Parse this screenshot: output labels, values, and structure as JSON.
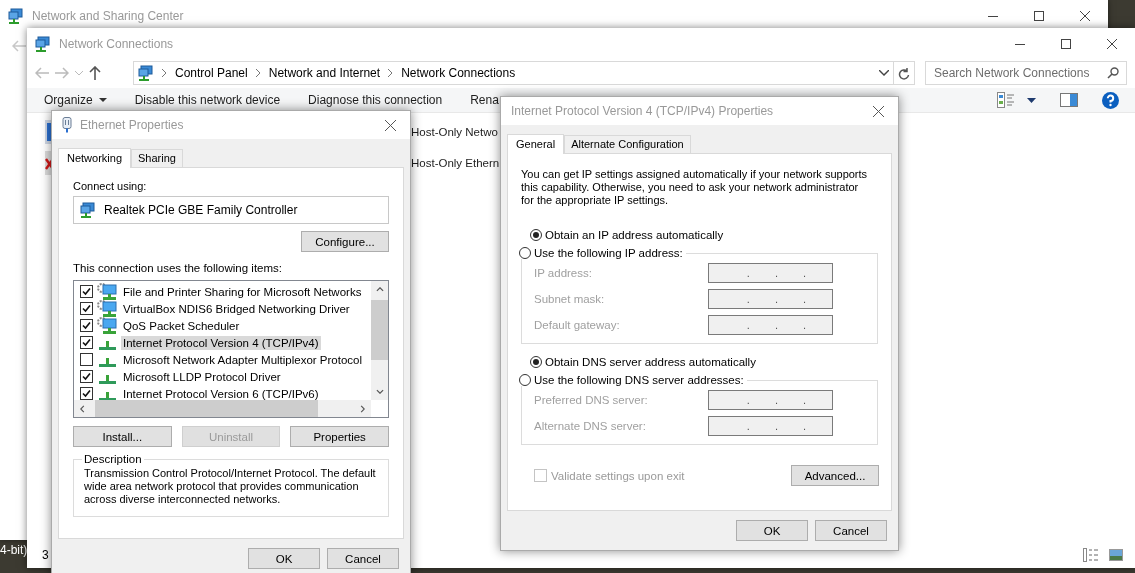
{
  "desktop": {
    "icon_label": "4-bit)"
  },
  "back_window": {
    "title": "Network and Sharing Center"
  },
  "explorer": {
    "title": "Network Connections",
    "breadcrumb": [
      "Control Panel",
      "Network and Internet",
      "Network Connections"
    ],
    "search": {
      "placeholder": "Search Network Connections"
    },
    "commands": [
      {
        "label": "Organize",
        "kind": "menu"
      },
      {
        "label": "Disable this network device",
        "kind": "action"
      },
      {
        "label": "Diagnose this connection",
        "kind": "action"
      },
      {
        "label": "Rena",
        "kind": "action"
      }
    ],
    "connections": [
      {
        "name": "Host-Only Netwo",
        "kind": "connected"
      },
      {
        "name": "Host-Only Ethern",
        "kind": "disconnected"
      }
    ],
    "status_bar": {
      "count": "3"
    }
  },
  "ethernet": {
    "title": "Ethernet Properties",
    "tabs": [
      {
        "label": "Networking",
        "selected": true
      },
      {
        "label": "Sharing",
        "selected": false
      }
    ],
    "connect_label": "Connect using:",
    "adapter": "Realtek PCIe GBE Family Controller",
    "configure": "Configure...",
    "items_label": "This connection uses the following items:",
    "items": [
      {
        "label": "File and Printer Sharing for Microsoft Networks",
        "kind": "service",
        "checked": true,
        "selected": false
      },
      {
        "label": "VirtualBox NDIS6 Bridged Networking Driver",
        "kind": "service",
        "checked": true,
        "selected": false
      },
      {
        "label": "QoS Packet Scheduler",
        "kind": "service",
        "checked": true,
        "selected": false
      },
      {
        "label": "Internet Protocol Version 4 (TCP/IPv4)",
        "kind": "protocol",
        "checked": true,
        "selected": true
      },
      {
        "label": "Microsoft Network Adapter Multiplexor Protocol",
        "kind": "protocol",
        "checked": false,
        "selected": false
      },
      {
        "label": "Microsoft LLDP Protocol Driver",
        "kind": "protocol",
        "checked": true,
        "selected": false
      },
      {
        "label": "Internet Protocol Version 6 (TCP/IPv6)",
        "kind": "protocol",
        "checked": true,
        "selected": false
      }
    ],
    "actions": [
      {
        "label": "Install...",
        "disabled": false
      },
      {
        "label": "Uninstall",
        "disabled": true
      },
      {
        "label": "Properties",
        "disabled": false
      }
    ],
    "description_title": "Description",
    "description": "Transmission Control Protocol/Internet Protocol. The default wide area network protocol that provides communication across diverse interconnected networks.",
    "ok": "OK",
    "cancel": "Cancel"
  },
  "ipv4": {
    "title": "Internet Protocol Version 4 (TCP/IPv4) Properties",
    "tabs": [
      {
        "label": "General",
        "selected": true
      },
      {
        "label": "Alternate Configuration",
        "selected": false
      }
    ],
    "intro": "You can get IP settings assigned automatically if your network supports this capability. Otherwise, you need to ask your network administrator for the appropriate IP settings.",
    "ip_options": [
      {
        "label": "Obtain an IP address automatically",
        "selected": true
      },
      {
        "label": "Use the following IP address:",
        "selected": false
      }
    ],
    "ip_fields": [
      {
        "label": "IP address:",
        "value": ". . .",
        "disabled": true
      },
      {
        "label": "Subnet mask:",
        "value": ". . .",
        "disabled": true
      },
      {
        "label": "Default gateway:",
        "value": ". . .",
        "disabled": true
      }
    ],
    "dns_options": [
      {
        "label": "Obtain DNS server address automatically",
        "selected": true
      },
      {
        "label": "Use the following DNS server addresses:",
        "selected": false
      }
    ],
    "dns_fields": [
      {
        "label": "Preferred DNS server:",
        "value": ". . .",
        "disabled": true
      },
      {
        "label": "Alternate DNS server:",
        "value": ". . .",
        "disabled": true
      }
    ],
    "validate": {
      "label": "Validate settings upon exit",
      "checked": false,
      "disabled": true
    },
    "advanced": "Advanced...",
    "ok": "OK",
    "cancel": "Cancel"
  }
}
